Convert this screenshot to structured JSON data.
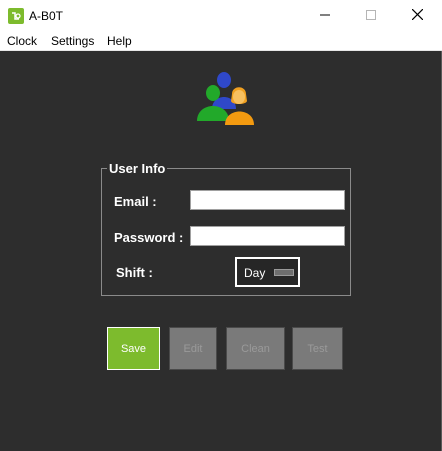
{
  "window": {
    "title": "A-B0T",
    "icon": "app-logo-icon",
    "controls": [
      "minimize-icon",
      "maximize-icon",
      "close-icon"
    ]
  },
  "menu": {
    "items": [
      {
        "label": "Clock"
      },
      {
        "label": "Settings"
      },
      {
        "label": "Help"
      }
    ]
  },
  "form": {
    "group_title": "User Info",
    "email_label": "Email :",
    "email_value": "",
    "password_label": "Password :",
    "password_value": "",
    "shift_label": "Shift :",
    "shift_value": "Day"
  },
  "buttons": {
    "save": "Save",
    "edit": "Edit",
    "clean": "Clean",
    "test": "Test"
  },
  "colors": {
    "background": "#2d2d2d",
    "accent_green": "#7dbb2d",
    "disabled_button": "#7a7a7a",
    "text": "#ffffff"
  }
}
